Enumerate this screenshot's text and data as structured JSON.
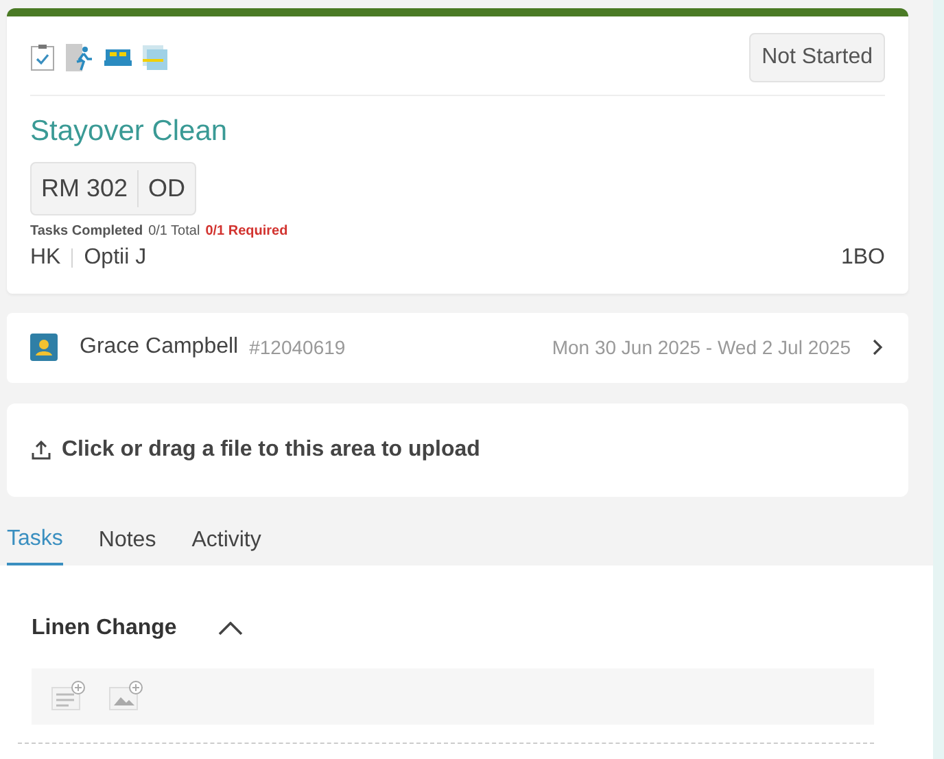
{
  "job": {
    "status": "Not Started",
    "title": "Stayover Clean",
    "room": "RM 302",
    "room_status": "OD",
    "tasks_label": "Tasks Completed",
    "tasks_total": "0/1 Total",
    "tasks_required": "0/1 Required",
    "department": "HK",
    "assignee": "Optii J",
    "code": "1BO"
  },
  "guest": {
    "name": "Grace Campbell",
    "reservation": "#12040619",
    "dates": "Mon 30 Jun 2025 - Wed 2 Jul 2025"
  },
  "upload": {
    "text": "Click or drag a file to this area to upload"
  },
  "tabs": [
    {
      "label": "Tasks",
      "selected": true
    },
    {
      "label": "Notes",
      "selected": false
    },
    {
      "label": "Activity",
      "selected": false
    }
  ],
  "task_group": {
    "title": "Linen Change",
    "expanded": true
  }
}
